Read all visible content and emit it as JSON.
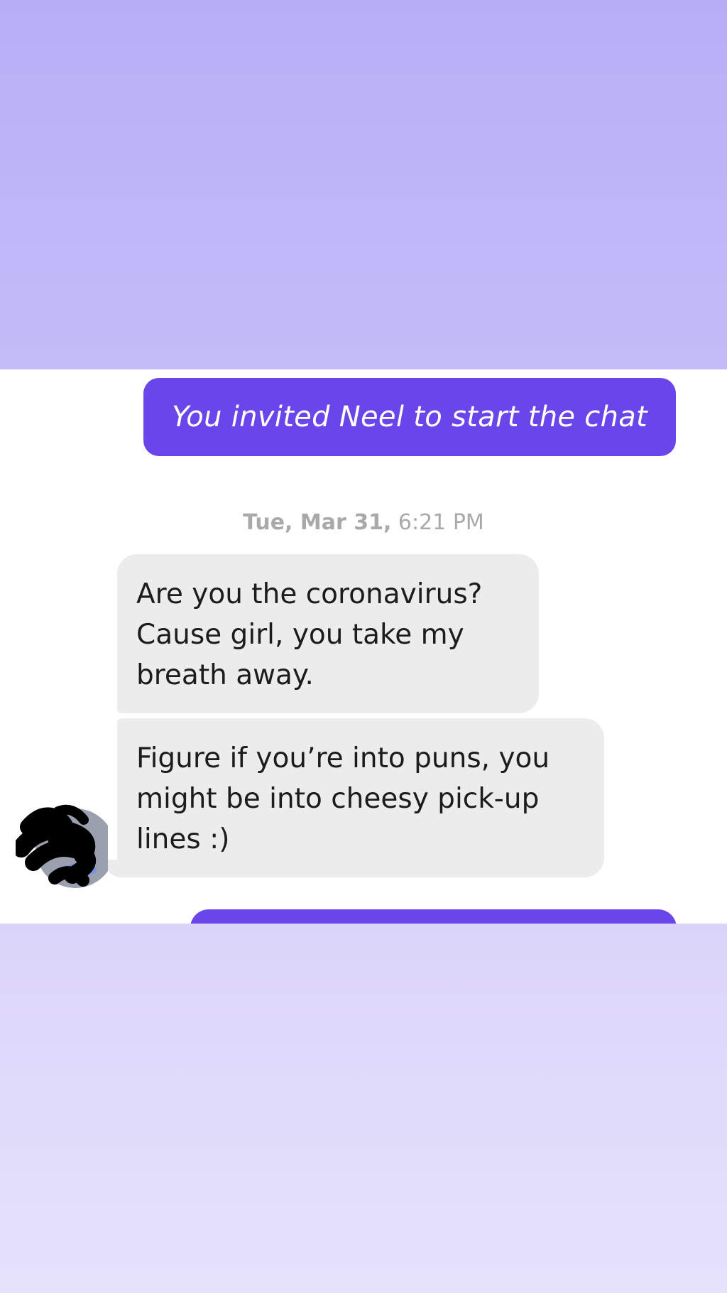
{
  "chat": {
    "invite_message": "You invited Neel to start the chat",
    "timestamp": {
      "date": "Tue, Mar 31,",
      "time": "6:21 PM"
    },
    "messages": [
      {
        "sender": "other",
        "text": "Are you the coronavirus?\nCause girl, you take my\nbreath away."
      },
      {
        "sender": "other",
        "text": "Figure if you’re into puns, you\nmight be into cheesy pick-up\nlines :)"
      }
    ],
    "avatar_icon": "avatar-redacted-icon",
    "colors": {
      "sent_bubble": "#6a46ea",
      "received_bubble": "#ececec",
      "background_top": "#b7aef7",
      "background_bottom": "#e6e2fc",
      "timestamp_text": "#a9a9a9"
    }
  }
}
